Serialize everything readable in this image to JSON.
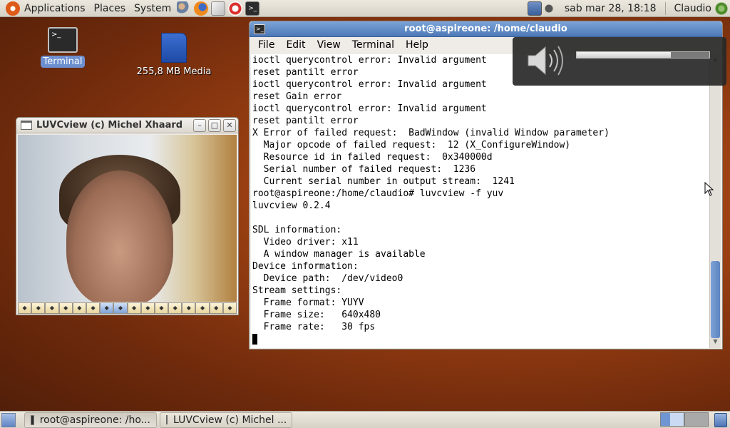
{
  "top_panel": {
    "menus": [
      "Applications",
      "Places",
      "System"
    ],
    "clock": "sab mar 28, 18:18",
    "user": "Claudio"
  },
  "desktop": {
    "icons": [
      {
        "label": "Terminal",
        "icon": "terminal-icon",
        "selected": true
      },
      {
        "label": "255,8 MB Media",
        "icon": "sd-card-icon",
        "selected": false
      }
    ]
  },
  "luvc_window": {
    "title": "LUVCview (c) Michel Xhaard",
    "toolbar_count": 16
  },
  "terminal_window": {
    "title": "root@aspireone: /home/claudio",
    "menu": [
      "File",
      "Edit",
      "View",
      "Terminal",
      "Help"
    ],
    "lines": [
      "ioctl querycontrol error: Invalid argument",
      "reset pantilt error",
      "ioctl querycontrol error: Invalid argument",
      "reset Gain error",
      "ioctl querycontrol error: Invalid argument",
      "reset pantilt error",
      "X Error of failed request:  BadWindow (invalid Window parameter)",
      "  Major opcode of failed request:  12 (X_ConfigureWindow)",
      "  Resource id in failed request:  0x340000d",
      "  Serial number of failed request:  1236",
      "  Current serial number in output stream:  1241",
      "root@aspireone:/home/claudio# luvcview -f yuv",
      "luvcview 0.2.4",
      "",
      "SDL information:",
      "  Video driver: x11",
      "  A window manager is available",
      "Device information:",
      "  Device path:  /dev/video0",
      "Stream settings:",
      "  Frame format: YUYV",
      "  Frame size:   640x480",
      "  Frame rate:   30 fps"
    ]
  },
  "volume_osd": {
    "icon": "speaker-icon",
    "level": 0.71
  },
  "taskbar": {
    "tasks": [
      {
        "label": "root@aspireone: /ho...",
        "icon": "terminal-icon",
        "active": true
      },
      {
        "label": "LUVCview (c) Michel ...",
        "icon": "window-icon",
        "active": false
      }
    ]
  }
}
